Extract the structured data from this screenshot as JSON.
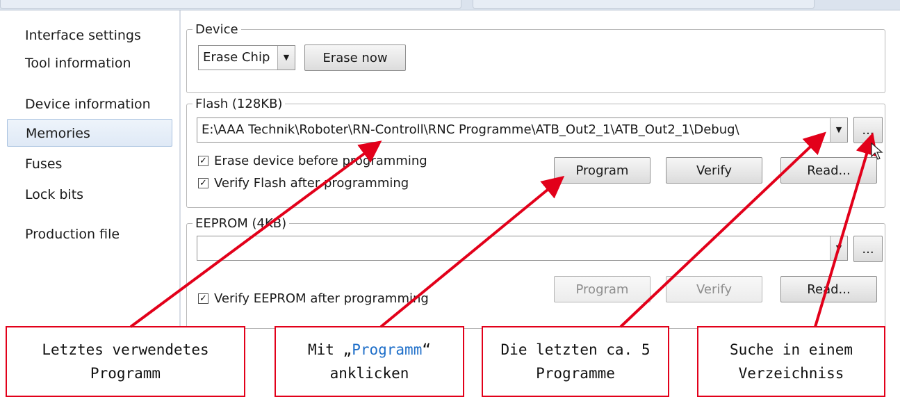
{
  "sidebar": {
    "items": [
      {
        "label": "Interface settings",
        "selected": false
      },
      {
        "label": "Tool information",
        "selected": false
      },
      {
        "label": "Device information",
        "selected": false
      },
      {
        "label": "Memories",
        "selected": true
      },
      {
        "label": "Fuses",
        "selected": false
      },
      {
        "label": "Lock bits",
        "selected": false
      },
      {
        "label": "Production file",
        "selected": false
      }
    ]
  },
  "device": {
    "legend": "Device",
    "erase_select_value": "Erase Chip",
    "erase_now_label": "Erase now"
  },
  "flash": {
    "legend": "Flash (128KB)",
    "path_value": "E:\\AAA Technik\\Roboter\\RN-Controll\\RNC Programme\\ATB_Out2_1\\ATB_Out2_1\\Debug\\",
    "browse_label": "...",
    "erase_before_label": "Erase device before programming",
    "erase_before_checked": true,
    "verify_after_label": "Verify Flash after programming",
    "verify_after_checked": true,
    "program_label": "Program",
    "verify_label": "Verify",
    "read_label": "Read..."
  },
  "eeprom": {
    "legend": "EEPROM (4KB)",
    "path_value": "",
    "browse_label": "...",
    "verify_after_label": "Verify EEPROM after programming",
    "verify_after_checked": true,
    "program_label": "Program",
    "verify_label": "Verify",
    "read_label": "Read..."
  },
  "annotations": {
    "callout_1": {
      "line1": "Letztes verwendetes",
      "line2": "Programm"
    },
    "callout_2": {
      "prefix": "Mit „",
      "highlight": "Programm",
      "suffix": "“",
      "line2": "anklicken"
    },
    "callout_3": {
      "line1": "Die letzten ca. 5",
      "line2": "Programme"
    },
    "callout_4": {
      "line1": "Suche in einem",
      "line2": "Verzeichniss"
    },
    "arrow_color": "#e2001a",
    "highlight_color": "#1f6fc9"
  }
}
